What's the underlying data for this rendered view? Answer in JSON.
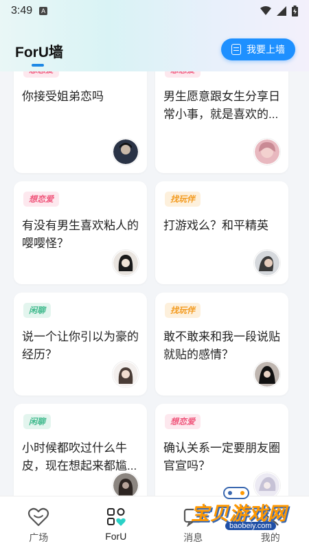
{
  "status_bar": {
    "time": "3:49",
    "notification_badge": "A"
  },
  "header": {
    "title": "ForU墙",
    "wall_button_label": "我要上墙"
  },
  "cards": [
    {
      "tag": "想恋爱",
      "tag_type": "love",
      "text": "你接受姐弟恋吗"
    },
    {
      "tag": "想恋爱",
      "tag_type": "love",
      "text": "男生愿意跟女生分享日常小事，就是喜欢的..."
    },
    {
      "tag": "想恋爱",
      "tag_type": "love",
      "text": "有没有男生喜欢粘人的嘤嘤怪？"
    },
    {
      "tag": "找玩伴",
      "tag_type": "play",
      "text": "打游戏么？和平精英"
    },
    {
      "tag": "闲聊",
      "tag_type": "chat",
      "text": "说一个让你引以为豪的经历？"
    },
    {
      "tag": "找玩伴",
      "tag_type": "play",
      "text": "敢不敢来和我一段说贴就贴的感情？"
    },
    {
      "tag": "闲聊",
      "tag_type": "chat",
      "text": "小时候都吹过什么牛皮，现在想起来都尴..."
    },
    {
      "tag": "想恋爱",
      "tag_type": "love",
      "text": "确认关系一定要朋友圈官宣吗？"
    }
  ],
  "tabs": [
    {
      "label": "广场",
      "icon": "heart-icon"
    },
    {
      "label": "ForU",
      "icon": "grid-heart-icon"
    },
    {
      "label": "消息",
      "icon": "message-icon"
    },
    {
      "label": "我的",
      "icon": "profile-icon"
    }
  ],
  "watermark": {
    "text": "宝贝游戏网",
    "url": "baobeiy.com"
  },
  "colors": {
    "accent": "#1e90ff",
    "love": "#f0577c",
    "play": "#f39b20",
    "chat": "#3fb98c"
  }
}
